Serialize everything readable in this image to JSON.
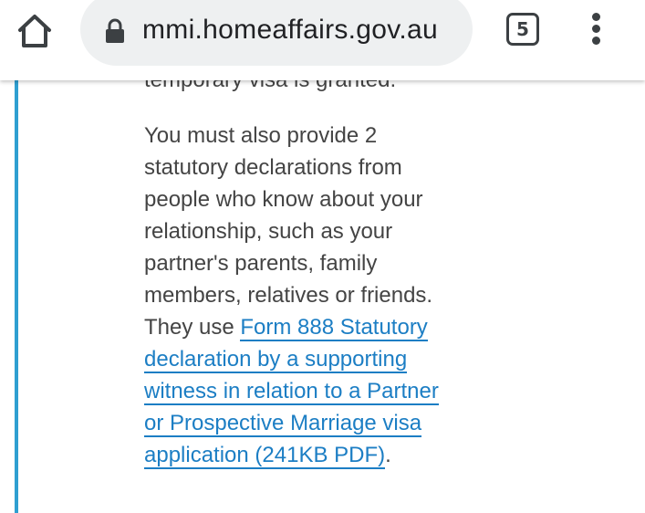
{
  "browser": {
    "url": "mmi.homeaffairs.gov.au",
    "tab_count": "5",
    "icons": {
      "home": "home-icon",
      "lock": "lock-icon",
      "menu": "more-vertical-icon"
    }
  },
  "content": {
    "cut_off_line": "temporary visa is granted.",
    "paragraph_text": "You must also provide 2 statutory declarations from people who know about your relationship, such as your partner's parents, family members, relatives or friends. They use ",
    "link_text": "Form 888 Statutory declaration by a supporting witness in relation to a Partner or Prospective Marriage visa application (241KB PDF)",
    "trailing": ".",
    "accent_color": "#2f9fd1",
    "link_color": "#1c7ec4"
  }
}
